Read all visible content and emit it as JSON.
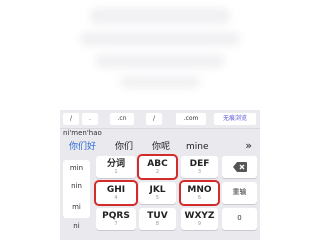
{
  "url_bar": {
    "keys": [
      "/",
      ".",
      ".cn",
      "/",
      ".com"
    ],
    "no_trace_label": "无痕浏览"
  },
  "pinyin": "ni'men'hao",
  "candidates": {
    "items": [
      "你们好",
      "你们",
      "你呢",
      "mine"
    ],
    "more": "»"
  },
  "left_column": [
    "min",
    "nin",
    "mi",
    "ni"
  ],
  "keys": [
    {
      "main": "分词",
      "sub": "1"
    },
    {
      "main": "ABC",
      "sub": "2"
    },
    {
      "main": "DEF",
      "sub": "3"
    },
    {
      "main": "GHI",
      "sub": "4"
    },
    {
      "main": "JKL",
      "sub": "5"
    },
    {
      "main": "MNO",
      "sub": "6"
    },
    {
      "main": "PQRS",
      "sub": "7"
    },
    {
      "main": "TUV",
      "sub": "8"
    },
    {
      "main": "WXYZ",
      "sub": "9"
    }
  ],
  "side_keys": {
    "backspace_icon": "backspace-icon",
    "reenter_label": "重输",
    "zero_label": "0"
  },
  "highlight_color": "#d32b2b",
  "accent": "#2e6bd6"
}
